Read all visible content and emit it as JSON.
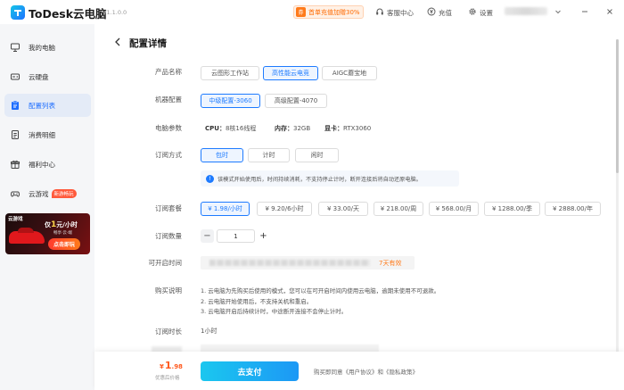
{
  "app": {
    "name": "ToDesk云电脑",
    "version": "V1.1.0.0"
  },
  "titlebar": {
    "promo": "首单充值加赠30%",
    "promo_icon_text": "券",
    "service": "客服中心",
    "recharge": "充值",
    "settings": "设置"
  },
  "sidebar": {
    "items": [
      {
        "label": "我的电脑",
        "icon": "computer-icon"
      },
      {
        "label": "云硬盘",
        "icon": "disk-icon"
      },
      {
        "label": "配置列表",
        "icon": "clipboard-icon"
      },
      {
        "label": "消费明细",
        "icon": "receipt-icon"
      },
      {
        "label": "福利中心",
        "icon": "gift-icon"
      },
      {
        "label": "云游戏",
        "icon": "gamepad-icon",
        "badge": "新游畅玩"
      }
    ],
    "ad": {
      "brand": "云游戏",
      "price_prefix": "仅",
      "price": "1",
      "price_unit": "元/小时",
      "sub": "畅享·云·端",
      "cta": "点击即玩"
    }
  },
  "page": {
    "title": "配置详情"
  },
  "form": {
    "product_label": "产品名称",
    "products": [
      "云图形工作站",
      "高性能云电竞",
      "AIGC蘑宝地"
    ],
    "product_selected": 1,
    "machine_label": "机器配置",
    "machines": [
      "中级配置-3060",
      "高级配置-4070"
    ],
    "machine_selected": 0,
    "params_label": "电脑参数",
    "params": [
      {
        "key": "CPU：",
        "value": "8核16线程"
      },
      {
        "key": "内存：",
        "value": "32GB"
      },
      {
        "key": "显卡：",
        "value": "RTX3060"
      }
    ],
    "sub_mode_label": "订阅方式",
    "sub_modes": [
      "包时",
      "计时",
      "闲时"
    ],
    "sub_mode_selected": 0,
    "tip": "该模式开始使用后，时间持续消耗，不支持停止计时，断开连接后将自动还原电脑。",
    "package_label": "订阅套餐",
    "packages": [
      "¥ 1.98/小时",
      "¥ 9.20/6小时",
      "¥ 33.00/天",
      "¥ 218.00/周",
      "¥ 568.00/月",
      "¥ 1288.00/季",
      "¥ 2888.00/年"
    ],
    "package_selected": 0,
    "qty_label": "订阅数量",
    "qty_value": "1",
    "minus": "−",
    "plus": "+",
    "start_time_label": "可开启时间",
    "start_time_flag": "7天有效",
    "purchase_label": "购买说明",
    "purchase_notes": [
      "1. 云电脑为先购买后使用的模式，您可以在可开启时间内使用云电脑，逾期未使用不可退款。",
      "2. 云电脑开始使用后，不支持关机和重启。",
      "3. 云电脑开启后持续计时，中途断开连接不会停止计时。"
    ],
    "duration_label": "订阅时长",
    "duration_value": "1小时"
  },
  "footer": {
    "price_symbol": "¥",
    "price_int": "1",
    "price_dec": ".98",
    "price_sub": "优惠后价格",
    "pay_button": "去支付",
    "agree_text": "购买即同意《用户协议》和《隐私政策》"
  },
  "colors": {
    "accent": "#1e7bff",
    "promo": "#ff6a00",
    "price": "#ff5a1f",
    "pay_gradient_start": "#1bc7ef",
    "pay_gradient_end": "#1c98f5"
  }
}
